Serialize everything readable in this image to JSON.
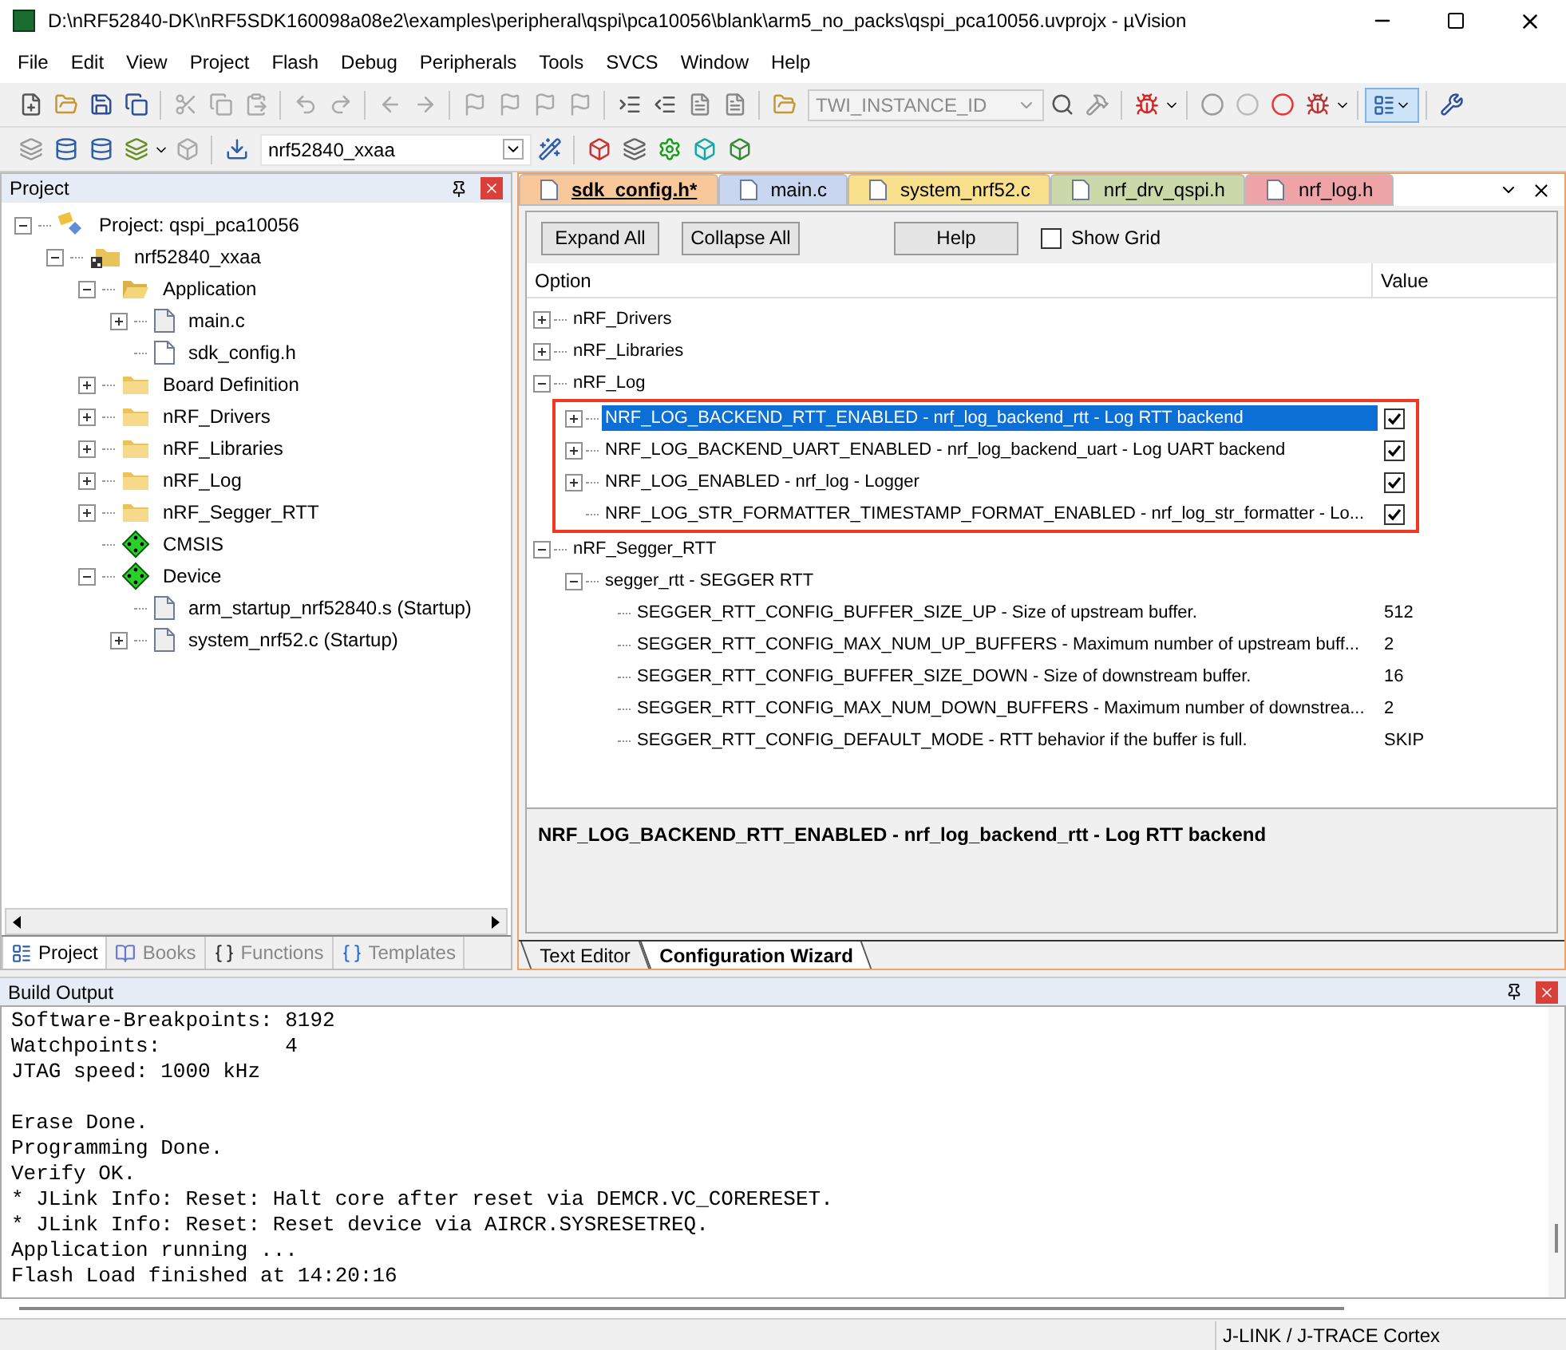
{
  "window": {
    "title": "D:\\nRF52840-DK\\nRF5SDK160098a08e2\\examples\\peripheral\\qspi\\pca10056\\blank\\arm5_no_packs\\qspi_pca10056.uvprojx - µVision"
  },
  "menu": [
    "File",
    "Edit",
    "View",
    "Project",
    "Flash",
    "Debug",
    "Peripherals",
    "Tools",
    "SVCS",
    "Window",
    "Help"
  ],
  "toolbar": {
    "find_combo": {
      "value": "TWI_INSTANCE_ID",
      "disabled": true
    },
    "target_combo": {
      "value": "nrf52840_xxaa"
    }
  },
  "project_panel": {
    "title": "Project",
    "tree": [
      {
        "label": "Project: qspi_pca10056",
        "kind": "project",
        "expanded": true,
        "children": [
          {
            "label": "nrf52840_xxaa",
            "kind": "target",
            "expanded": true,
            "children": [
              {
                "label": "Application",
                "kind": "folder",
                "expanded": true,
                "children": [
                  {
                    "label": "main.c",
                    "kind": "file",
                    "expanded": false
                  },
                  {
                    "label": "sdk_config.h",
                    "kind": "header"
                  }
                ]
              },
              {
                "label": "Board Definition",
                "kind": "folder",
                "expanded": false
              },
              {
                "label": "nRF_Drivers",
                "kind": "folder",
                "expanded": false
              },
              {
                "label": "nRF_Libraries",
                "kind": "folder",
                "expanded": false
              },
              {
                "label": "nRF_Log",
                "kind": "folder",
                "expanded": false
              },
              {
                "label": "nRF_Segger_RTT",
                "kind": "folder",
                "expanded": false
              },
              {
                "label": "CMSIS",
                "kind": "component"
              },
              {
                "label": "Device",
                "kind": "component",
                "expanded": true,
                "children": [
                  {
                    "label": "arm_startup_nrf52840.s (Startup)",
                    "kind": "file"
                  },
                  {
                    "label": "system_nrf52.c (Startup)",
                    "kind": "file",
                    "expanded": false
                  }
                ]
              }
            ]
          }
        ]
      }
    ],
    "tabs": [
      {
        "label": "Project",
        "kind": "project",
        "selected": true
      },
      {
        "label": "Books",
        "kind": "books",
        "selected": false
      },
      {
        "label": "Functions",
        "kind": "functions",
        "selected": false
      },
      {
        "label": "Templates",
        "kind": "templates",
        "selected": false
      }
    ]
  },
  "editor": {
    "tabs": [
      {
        "label": "sdk_config.h*",
        "color": "#f8c79a",
        "selected": true
      },
      {
        "label": "main.c",
        "color": "#c8d6f0",
        "selected": false
      },
      {
        "label": "system_nrf52.c",
        "color": "#f7df8c",
        "selected": false
      },
      {
        "label": "nrf_drv_qspi.h",
        "color": "#cbd9aa",
        "selected": false
      },
      {
        "label": "nrf_log.h",
        "color": "#eea3a6",
        "selected": false
      }
    ],
    "buttons": [
      "Expand All",
      "Collapse All",
      "Help"
    ],
    "show_grid": {
      "label": "Show Grid",
      "checked": false
    },
    "columns": [
      "Option",
      "Value"
    ],
    "options": [
      {
        "label": "nRF_Drivers",
        "expanded": false
      },
      {
        "label": "nRF_Libraries",
        "expanded": false
      },
      {
        "label": "nRF_Log",
        "expanded": true,
        "highlighted": true,
        "children": [
          {
            "label": "NRF_LOG_BACKEND_RTT_ENABLED - nrf_log_backend_rtt - Log RTT backend",
            "kind": "checkbox",
            "checked": true,
            "selected": true,
            "expanded": false
          },
          {
            "label": "NRF_LOG_BACKEND_UART_ENABLED - nrf_log_backend_uart - Log UART backend",
            "kind": "checkbox",
            "checked": true,
            "selected": false,
            "expanded": false
          },
          {
            "label": "NRF_LOG_ENABLED - nrf_log - Logger",
            "kind": "checkbox",
            "checked": true,
            "selected": false,
            "expanded": false
          },
          {
            "label": "NRF_LOG_STR_FORMATTER_TIMESTAMP_FORMAT_ENABLED  - nrf_log_str_formatter - Lo...",
            "kind": "checkbox",
            "checked": true,
            "selected": false
          }
        ]
      },
      {
        "label": "nRF_Segger_RTT",
        "expanded": true,
        "children": [
          {
            "label": "segger_rtt - SEGGER RTT",
            "expanded": true,
            "children": [
              {
                "label": "SEGGER_RTT_CONFIG_BUFFER_SIZE_UP - Size of upstream buffer.",
                "kind": "value",
                "value": "512"
              },
              {
                "label": "SEGGER_RTT_CONFIG_MAX_NUM_UP_BUFFERS - Maximum number of upstream buff...",
                "kind": "value",
                "value": "2"
              },
              {
                "label": "SEGGER_RTT_CONFIG_BUFFER_SIZE_DOWN - Size of downstream buffer.",
                "kind": "value",
                "value": "16"
              },
              {
                "label": "SEGGER_RTT_CONFIG_MAX_NUM_DOWN_BUFFERS - Maximum number of downstrea...",
                "kind": "value",
                "value": "2"
              },
              {
                "label": "SEGGER_RTT_CONFIG_DEFAULT_MODE  - RTT behavior if the buffer is full.",
                "kind": "value",
                "value": "SKIP"
              }
            ]
          }
        ]
      }
    ],
    "description": "NRF_LOG_BACKEND_RTT_ENABLED - nrf_log_backend_rtt - Log RTT backend",
    "bottom_tabs": [
      {
        "label": "Text Editor",
        "selected": false
      },
      {
        "label": "Configuration Wizard",
        "selected": true
      }
    ]
  },
  "build_output": {
    "title": "Build Output",
    "blocks": [
      [
        "Software-Breakpoints: 8192",
        "Watchpoints:          4",
        "JTAG speed: 1000 kHz"
      ],
      [
        "Erase Done.",
        "Programming Done.",
        "Verify OK.",
        "* JLink Info: Reset: Halt core after reset via DEMCR.VC_CORERESET.",
        "* JLink Info: Reset: Reset device via AIRCR.SYSRESETREQ.",
        "Application running ...",
        "Flash Load finished at 14:20:16"
      ]
    ]
  },
  "status_bar": {
    "debugger": "J-LINK / J-TRACE Cortex"
  }
}
